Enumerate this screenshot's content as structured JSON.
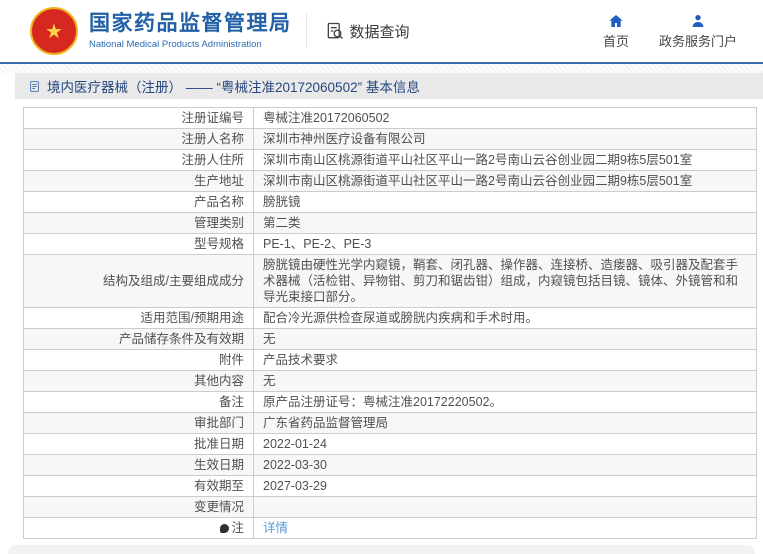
{
  "header": {
    "brand_cn": "国家药品监督管理局",
    "brand_en": "National Medical Products Administration",
    "data_query_label": "数据查询",
    "nav": [
      {
        "label": "首页",
        "icon": "home-icon"
      },
      {
        "label": "政务服务门户",
        "icon": "user-icon"
      }
    ]
  },
  "breadcrumb": {
    "title": "境内医疗器械（注册） —— “粤械注准20172060502” 基本信息",
    "icon": "document-icon"
  },
  "table": {
    "rows": [
      {
        "label": "注册证编号",
        "value": "粤械注准20172060502"
      },
      {
        "label": "注册人名称",
        "value": "深圳市神州医疗设备有限公司"
      },
      {
        "label": "注册人住所",
        "value": "深圳市南山区桃源街道平山社区平山一路2号南山云谷创业园二期9栋5层501室"
      },
      {
        "label": "生产地址",
        "value": "深圳市南山区桃源街道平山社区平山一路2号南山云谷创业园二期9栋5层501室"
      },
      {
        "label": "产品名称",
        "value": "膀胱镜"
      },
      {
        "label": "管理类别",
        "value": "第二类"
      },
      {
        "label": "型号规格",
        "value": "PE-1、PE-2、PE-3"
      },
      {
        "label": "结构及组成/主要组成成分",
        "value": "膀胱镜由硬性光学内窥镜，鞘套、闭孔器、操作器、连接桥、造瘘器、吸引器及配套手术器械（活检钳、异物钳、剪刀和锯齿钳）组成，内窥镜包括目镜、镜体、外镜管和和导光束接口部分。"
      },
      {
        "label": "适用范围/预期用途",
        "value": "配合冷光源供检查尿道或膀胱内疾病和手术时用。"
      },
      {
        "label": "产品储存条件及有效期",
        "value": "无"
      },
      {
        "label": "附件",
        "value": "产品技术要求"
      },
      {
        "label": "其他内容",
        "value": "无"
      },
      {
        "label": "备注",
        "value": "原产品注册证号：粤械注准20172220502。"
      },
      {
        "label": "审批部门",
        "value": "广东省药品监督管理局"
      },
      {
        "label": "批准日期",
        "value": "2022-01-24"
      },
      {
        "label": "生效日期",
        "value": "2022-03-30"
      },
      {
        "label": "有效期至",
        "value": "2027-03-29"
      },
      {
        "label": "变更情况",
        "value": ""
      },
      {
        "label": "注",
        "value": "详情",
        "label_icon": "note-icon",
        "link": true
      }
    ]
  },
  "icons": {
    "emblem": "national-emblem-icon",
    "data_query": "document-search-icon",
    "home": "home-icon",
    "portal": "user-icon",
    "breadcrumb": "document-icon",
    "note": "note-icon"
  },
  "colors": {
    "brand_blue": "#2360a5",
    "nav_icon_blue": "#1f5fc4",
    "breadcrumb_text": "#26477e",
    "link_blue": "#5b9bd5",
    "emblem_red": "#d6281e",
    "emblem_gold": "#f0b51e",
    "row_alt_bg": "#f7f7f7",
    "border_gray": "#cccccc"
  }
}
